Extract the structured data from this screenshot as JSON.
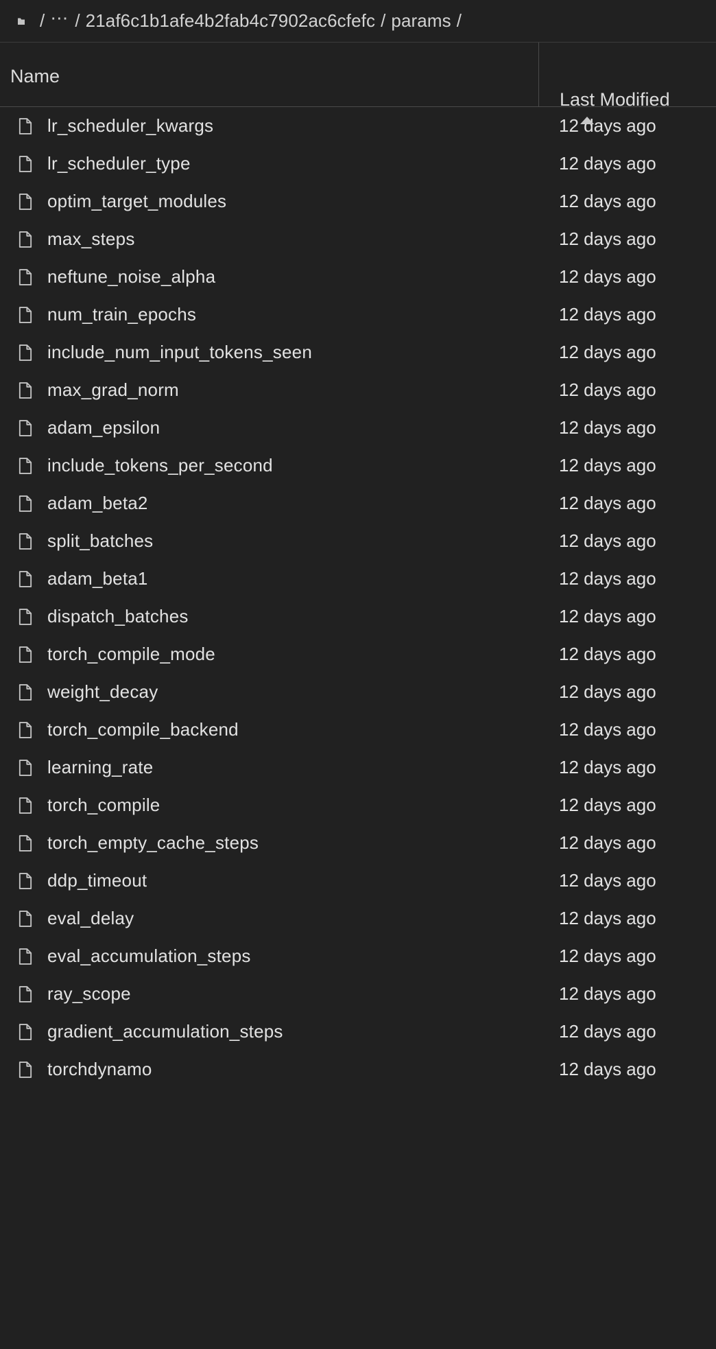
{
  "breadcrumb": {
    "root_icon": "folder-icon",
    "separator": "/",
    "ellipsis": "⋯",
    "segments": [
      {
        "label": "21af6c1b1afe4b2fab4c7902ac6cfefc"
      },
      {
        "label": "params"
      }
    ]
  },
  "columns": {
    "name": "Name",
    "last_modified": "Last Modified",
    "sort_column": "Last Modified",
    "sort_direction": "ascending",
    "sort_icon": "triangle-up-icon"
  },
  "colors": {
    "background": "#212121",
    "divider": "#4a4a4a",
    "text": "#e2e2e2",
    "icon": "#c8c8c8"
  },
  "files": [
    {
      "icon": "file-icon",
      "name": "lr_scheduler_kwargs",
      "last_modified": "12 days ago"
    },
    {
      "icon": "file-icon",
      "name": "lr_scheduler_type",
      "last_modified": "12 days ago"
    },
    {
      "icon": "file-icon",
      "name": "optim_target_modules",
      "last_modified": "12 days ago"
    },
    {
      "icon": "file-icon",
      "name": "max_steps",
      "last_modified": "12 days ago"
    },
    {
      "icon": "file-icon",
      "name": "neftune_noise_alpha",
      "last_modified": "12 days ago"
    },
    {
      "icon": "file-icon",
      "name": "num_train_epochs",
      "last_modified": "12 days ago"
    },
    {
      "icon": "file-icon",
      "name": "include_num_input_tokens_seen",
      "last_modified": "12 days ago"
    },
    {
      "icon": "file-icon",
      "name": "max_grad_norm",
      "last_modified": "12 days ago"
    },
    {
      "icon": "file-icon",
      "name": "adam_epsilon",
      "last_modified": "12 days ago"
    },
    {
      "icon": "file-icon",
      "name": "include_tokens_per_second",
      "last_modified": "12 days ago"
    },
    {
      "icon": "file-icon",
      "name": "adam_beta2",
      "last_modified": "12 days ago"
    },
    {
      "icon": "file-icon",
      "name": "split_batches",
      "last_modified": "12 days ago"
    },
    {
      "icon": "file-icon",
      "name": "adam_beta1",
      "last_modified": "12 days ago"
    },
    {
      "icon": "file-icon",
      "name": "dispatch_batches",
      "last_modified": "12 days ago"
    },
    {
      "icon": "file-icon",
      "name": "torch_compile_mode",
      "last_modified": "12 days ago"
    },
    {
      "icon": "file-icon",
      "name": "weight_decay",
      "last_modified": "12 days ago"
    },
    {
      "icon": "file-icon",
      "name": "torch_compile_backend",
      "last_modified": "12 days ago"
    },
    {
      "icon": "file-icon",
      "name": "learning_rate",
      "last_modified": "12 days ago"
    },
    {
      "icon": "file-icon",
      "name": "torch_compile",
      "last_modified": "12 days ago"
    },
    {
      "icon": "file-icon",
      "name": "torch_empty_cache_steps",
      "last_modified": "12 days ago"
    },
    {
      "icon": "file-icon",
      "name": "ddp_timeout",
      "last_modified": "12 days ago"
    },
    {
      "icon": "file-icon",
      "name": "eval_delay",
      "last_modified": "12 days ago"
    },
    {
      "icon": "file-icon",
      "name": "eval_accumulation_steps",
      "last_modified": "12 days ago"
    },
    {
      "icon": "file-icon",
      "name": "ray_scope",
      "last_modified": "12 days ago"
    },
    {
      "icon": "file-icon",
      "name": "gradient_accumulation_steps",
      "last_modified": "12 days ago"
    },
    {
      "icon": "file-icon",
      "name": "torchdynamo",
      "last_modified": "12 days ago"
    }
  ]
}
